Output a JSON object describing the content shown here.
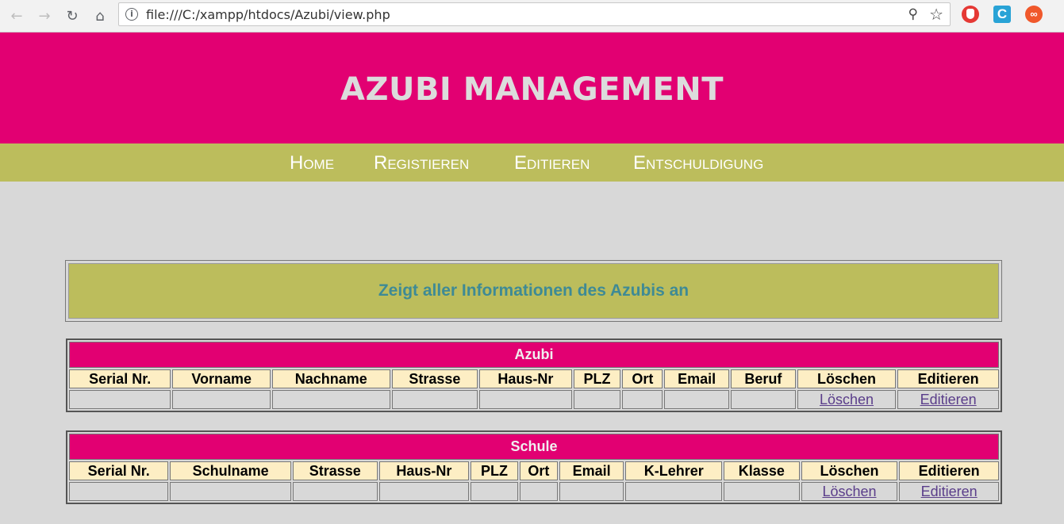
{
  "browser": {
    "url": "file:///C:/xampp/htdocs/Azubi/view.php"
  },
  "header": {
    "title": "AZUBI MANAGEMENT"
  },
  "menu": [
    {
      "label": "Home"
    },
    {
      "label": "Registieren"
    },
    {
      "label": "Editieren"
    },
    {
      "label": "Entschuldigung"
    }
  ],
  "info": {
    "message": "Zeigt aller Informationen des Azubis an"
  },
  "azubi_table": {
    "title": "Azubi",
    "columns": [
      "Serial Nr.",
      "Vorname",
      "Nachname",
      "Strasse",
      "Haus-Nr",
      "PLZ",
      "Ort",
      "Email",
      "Beruf",
      "Löschen",
      "Editieren"
    ],
    "row": {
      "delete_link": "Löschen",
      "edit_link": "Editieren"
    }
  },
  "schule_table": {
    "title": "Schule",
    "columns": [
      "Serial Nr.",
      "Schulname",
      "Strasse",
      "Haus-Nr",
      "PLZ",
      "Ort",
      "Email",
      "K-Lehrer",
      "Klasse",
      "Löschen",
      "Editieren"
    ],
    "row": {
      "delete_link": "Löschen",
      "edit_link": "Editieren"
    }
  },
  "colors": {
    "header_bg": "#e20072",
    "menu_bg": "#bcbd5c",
    "page_bg": "#d8d8d8",
    "table_header_bg": "#fdeec4",
    "info_text": "#3e8a95"
  }
}
